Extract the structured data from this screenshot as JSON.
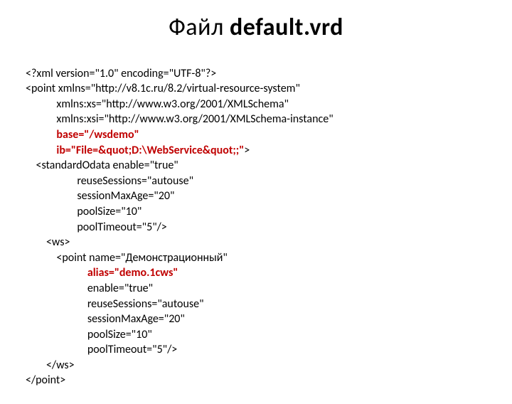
{
  "title_prefix": "Файл ",
  "title_bold": "default.vrd",
  "lines": {
    "l0": "<?xml version=\"1.0\" encoding=\"UTF-8\"?>",
    "l1": "<point xmlns=\"http://v8.1c.ru/8.2/virtual-resource-system\"",
    "l2": "            xmlns:xs=\"http://www.w3.org/2001/XMLSchema\"",
    "l3": "            xmlns:xsi=\"http://www.w3.org/2001/XMLSchema-instance\"",
    "l4": "            base=\"/wsdemo\"",
    "l5a": "            ib=\"File=&quot;D:\\WebService&quot;;\"",
    "l5b": ">",
    "l6": "    <standardOdata enable=\"true\"",
    "l7": "                    reuseSessions=\"autouse\"",
    "l8": "                    sessionMaxAge=\"20\"",
    "l9": "                    poolSize=\"10\"",
    "l10": "                    poolTimeout=\"5\"/>",
    "l11": "        <ws>",
    "l12": "            <point name=\"Демонстрационный\"",
    "l13": "                        alias=\"demo.1cws\"",
    "l14": "                        enable=\"true\"",
    "l15": "                        reuseSessions=\"autouse\"",
    "l16": "                        sessionMaxAge=\"20\"",
    "l17": "                        poolSize=\"10\"",
    "l18": "                        poolTimeout=\"5\"/>",
    "l19": "        </ws>",
    "l20": "</point>"
  }
}
